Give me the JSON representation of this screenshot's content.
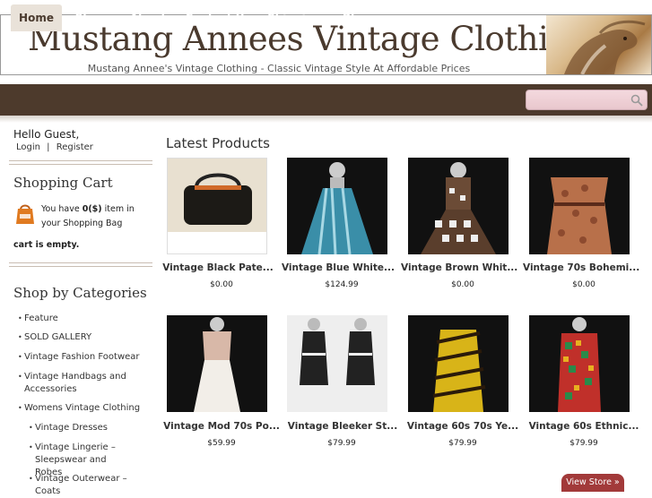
{
  "header": {
    "title": "Mustang Annees Vintage Clothing",
    "tagline": "Mustang Annee's Vintage Clothing - Classic Vintage Style At Affordable Prices"
  },
  "nav": {
    "items": [
      "Home",
      "Store",
      "About",
      "Contact Us",
      "Shipping",
      "Blog"
    ],
    "active": "Home"
  },
  "search": {
    "placeholder": "",
    "icon": "search-icon"
  },
  "sidebar": {
    "greeting": "Hello Guest,",
    "login": "Login",
    "separator": "|",
    "register": "Register",
    "cart_heading": "Shopping Cart",
    "cart_text_prefix": "You have ",
    "cart_count": "0($)",
    "cart_text_suffix": " item in your Shopping Bag",
    "cart_status": "cart is empty.",
    "categories_heading": "Shop by Categories",
    "categories": [
      "Feature",
      "SOLD GALLERY",
      "Vintage Fashion Footwear",
      "Vintage Handbags and Accessories",
      "Womens Vintage Clothing"
    ],
    "subcategories": [
      "Vintage Dresses",
      "Vintage Lingerie – Sleepswear and Robes",
      "Vintage Outerwear – Coats"
    ]
  },
  "main": {
    "title": "Latest Products",
    "products": [
      {
        "name": "Vintage Black Pate...",
        "price": "$0.00"
      },
      {
        "name": "Vintage Blue White...",
        "price": "$124.99"
      },
      {
        "name": "Vintage Brown Whit...",
        "price": "$0.00"
      },
      {
        "name": "Vintage 70s Bohemi...",
        "price": "$0.00"
      },
      {
        "name": "Vintage Mod 70s Po...",
        "price": "$59.99"
      },
      {
        "name": "Vintage Bleeker St...",
        "price": "$79.99"
      },
      {
        "name": "Vintage 60s 70s Ye...",
        "price": "$79.99"
      },
      {
        "name": "Vintage 60s Ethnic...",
        "price": "$79.99"
      }
    ],
    "view_store": "View Store »"
  },
  "colors": {
    "nav_bg": "#4d3a2c",
    "nav_active_bg": "#e9e2d9",
    "title_color": "#4a3a2e",
    "button_bg": "#a23a3a"
  }
}
